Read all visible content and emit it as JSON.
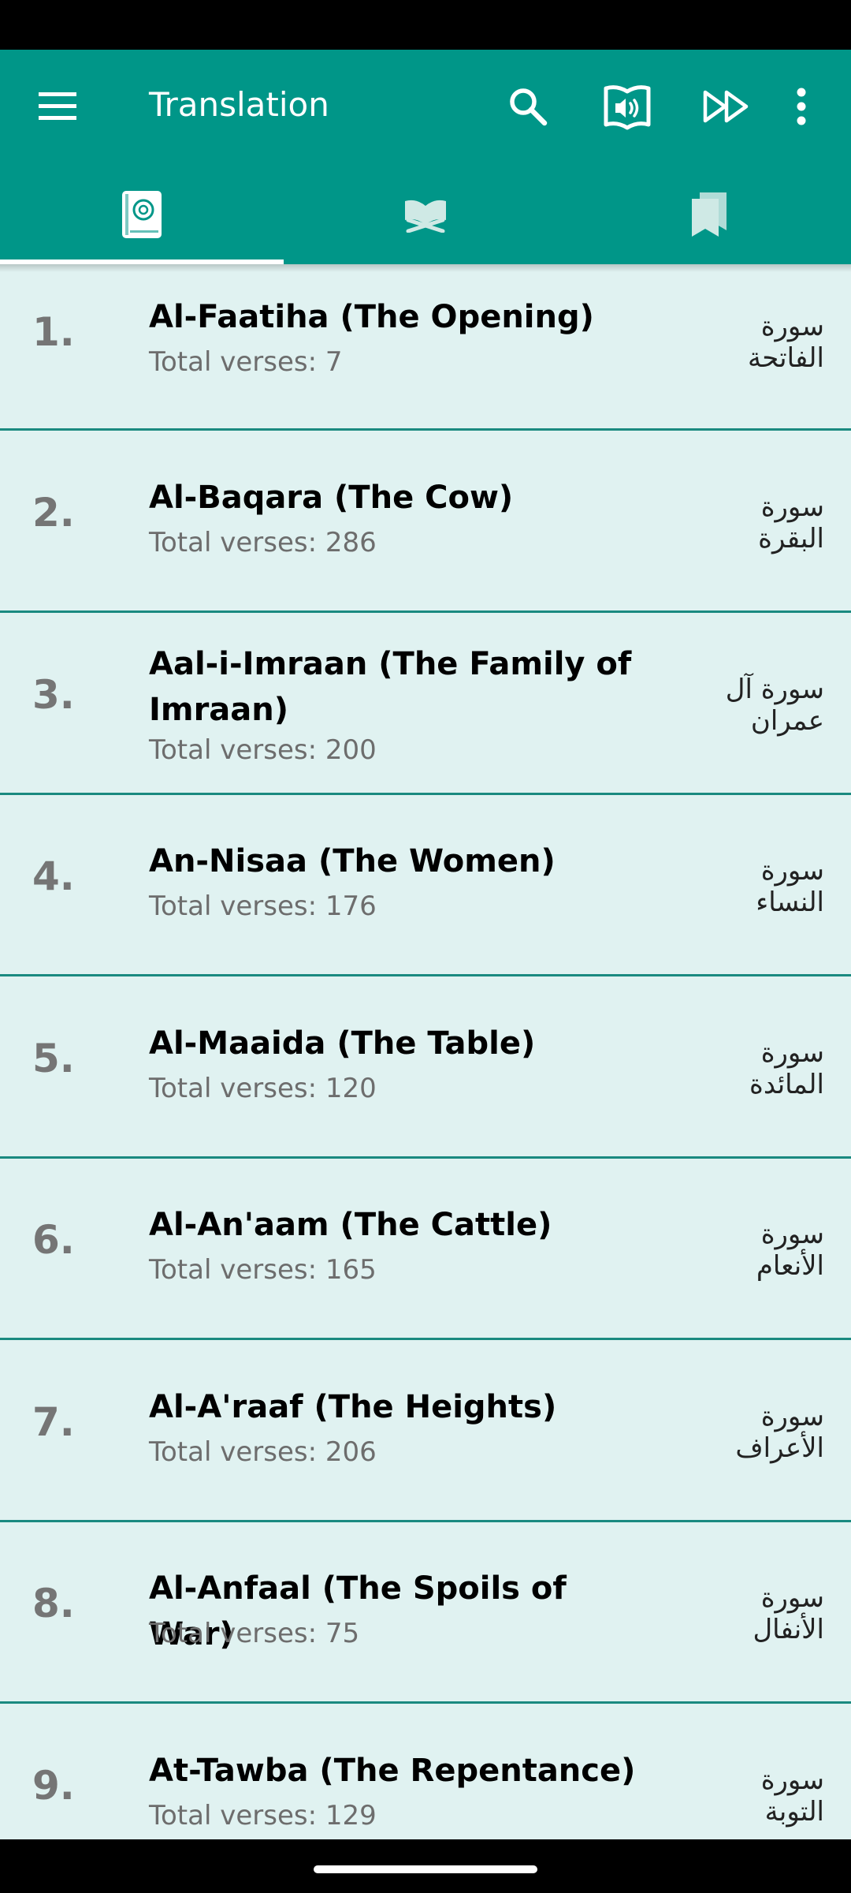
{
  "toolbar": {
    "title": "Translation",
    "icons": [
      "menu-icon",
      "search-icon",
      "audio-book-icon",
      "fast-forward-icon",
      "more-vert-icon"
    ]
  },
  "tabs": [
    {
      "icon": "quran-book-icon",
      "selected": true
    },
    {
      "icon": "open-book-icon",
      "selected": false
    },
    {
      "icon": "bookmarks-icon",
      "selected": false
    }
  ],
  "colors": {
    "primary": "#009688",
    "list_background": "#e0f2f1",
    "divider": "#1a8a80",
    "number": "#757575",
    "subtitle": "#6d6d6d"
  },
  "surahs": [
    {
      "num": "1.",
      "title": "Al-Faatiha (The Opening)",
      "verses": "Total verses: 7",
      "arabic": "سورة الفاتحة"
    },
    {
      "num": "2.",
      "title": "Al-Baqara (The Cow)",
      "verses": "Total verses: 286",
      "arabic": "سورة البقرة"
    },
    {
      "num": "3.",
      "title": "Aal-i-Imraan (The Family of Imraan)",
      "verses": "Total verses: 200",
      "arabic": "سورة آل عمران"
    },
    {
      "num": "4.",
      "title": "An-Nisaa (The Women)",
      "verses": "Total verses: 176",
      "arabic": "سورة النساء"
    },
    {
      "num": "5.",
      "title": "Al-Maaida (The Table)",
      "verses": "Total verses: 120",
      "arabic": "سورة المائدة"
    },
    {
      "num": "6.",
      "title": "Al-An'aam (The Cattle)",
      "verses": "Total verses: 165",
      "arabic": "سورة الأنعام"
    },
    {
      "num": "7.",
      "title": "Al-A'raaf (The Heights)",
      "verses": "Total verses: 206",
      "arabic": "سورة الأعراف"
    },
    {
      "num": "8.",
      "title": "Al-Anfaal (The Spoils of War)",
      "verses": "Total verses: 75",
      "arabic": "سورة الأنفال"
    },
    {
      "num": "9.",
      "title": "At-Tawba (The Repentance)",
      "verses": "Total verses: 129",
      "arabic": "سورة التوبة"
    }
  ]
}
